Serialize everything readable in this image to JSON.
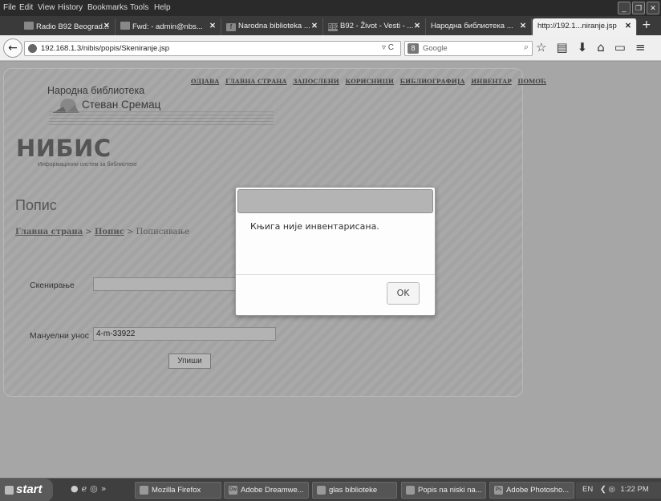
{
  "menubar": {
    "items": [
      "File",
      "Edit",
      "View",
      "History",
      "Bookmarks",
      "Tools",
      "Help"
    ]
  },
  "tabs": [
    {
      "label": "Radio B92 Beograd...",
      "icon": "radio-icon"
    },
    {
      "label": "Fwd: - admin@nbs...",
      "icon": "mail-icon"
    },
    {
      "label": "Narodna biblioteka ...",
      "icon": "facebook-icon"
    },
    {
      "label": "B92 - Život - Vesti - ...",
      "icon": "b92-icon",
      "icon_text": "B92"
    },
    {
      "label": "Народна библиотека ...",
      "icon": "page-icon"
    },
    {
      "label": "http://192.1...niranje.jsp",
      "icon": "page-icon",
      "active": true
    }
  ],
  "navbar": {
    "url": "192.168.1.3/nibis/popis/Skeniranje.jsp",
    "search_placeholder": "Google",
    "search_engine_icon": "google-icon"
  },
  "site": {
    "topnav": [
      "ОДЈАВА",
      "ГЛАВНА СТРАНА",
      "ЗАПОСЛЕНИ",
      "КОРИСНИЦИ",
      "БИБЛИОГРАФИЈА",
      "ИНВЕНТАР",
      "ПОМОЋ"
    ],
    "library_line1": "Народна библиотека",
    "library_line2": "Стеван Сремац",
    "brand": "НИБИС",
    "tagline": "Информациони систем за библиотеке",
    "page_title": "Попис",
    "breadcrumb": {
      "home": "Главна страна",
      "sep1": " > ",
      "popis": "Попис",
      "sep2": " > ",
      "current": "Пописивање"
    },
    "scan_label": "Скенирање",
    "scan_value": "",
    "manual_label": "Мануелни унос",
    "manual_value": "4-m-33922",
    "submit_label": "Упиши"
  },
  "modal": {
    "message": "Књига није инвентарисана.",
    "ok_label": "OK"
  },
  "taskbar": {
    "start_label": "start",
    "items": [
      {
        "label": "Mozilla Firefox",
        "icon": "firefox-icon"
      },
      {
        "label": "Adobe Dreamwe...",
        "icon": "dreamweaver-icon",
        "icon_text": "Dw"
      },
      {
        "label": "glas biblioteke",
        "icon": "folder-icon"
      },
      {
        "label": "Popis na niski na...",
        "icon": "document-icon"
      },
      {
        "label": "Adobe Photosho...",
        "icon": "photoshop-icon",
        "icon_text": "Ps"
      }
    ],
    "language": "EN",
    "time": "1:22 PM"
  }
}
